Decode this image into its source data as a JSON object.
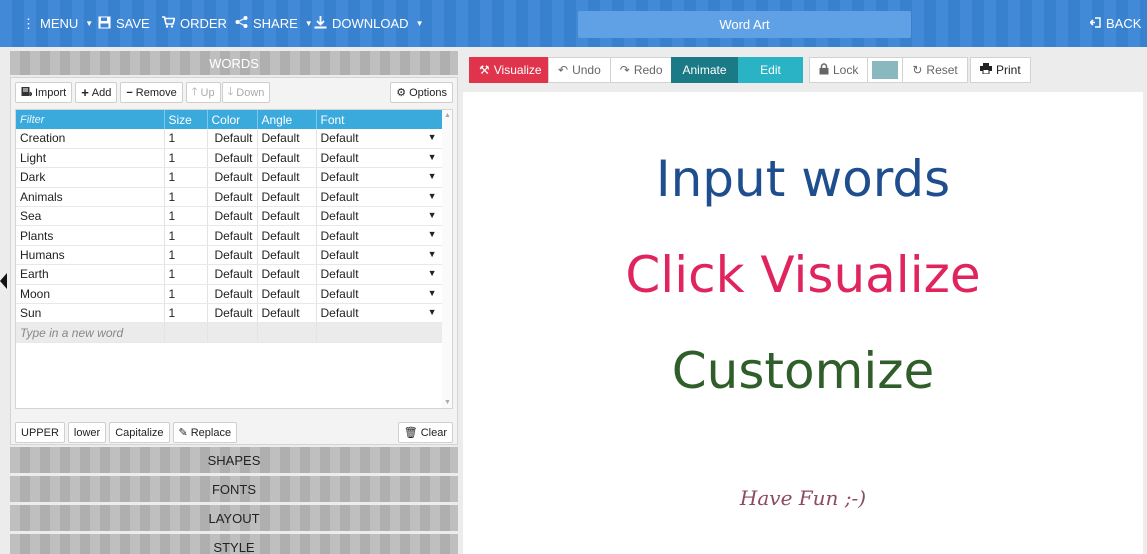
{
  "topbar": {
    "menu": "MENU",
    "save": "SAVE",
    "order": "ORDER",
    "share": "SHARE",
    "download": "DOWNLOAD",
    "title": "Word Art",
    "back": "BACK"
  },
  "words_panel": {
    "header": "WORDS",
    "toolbar": {
      "import": "Import",
      "add": "Add",
      "remove": "Remove",
      "up": "Up",
      "down": "Down",
      "options": "Options"
    },
    "columns": {
      "filter": "Filter",
      "size": "Size",
      "color": "Color",
      "angle": "Angle",
      "font": "Font"
    },
    "rows": [
      {
        "word": "Creation",
        "size": "1",
        "color": "Default",
        "angle": "Default",
        "font": "Default"
      },
      {
        "word": "Light",
        "size": "1",
        "color": "Default",
        "angle": "Default",
        "font": "Default"
      },
      {
        "word": "Dark",
        "size": "1",
        "color": "Default",
        "angle": "Default",
        "font": "Default"
      },
      {
        "word": "Animals",
        "size": "1",
        "color": "Default",
        "angle": "Default",
        "font": "Default"
      },
      {
        "word": "Sea",
        "size": "1",
        "color": "Default",
        "angle": "Default",
        "font": "Default"
      },
      {
        "word": "Plants",
        "size": "1",
        "color": "Default",
        "angle": "Default",
        "font": "Default"
      },
      {
        "word": "Humans",
        "size": "1",
        "color": "Default",
        "angle": "Default",
        "font": "Default"
      },
      {
        "word": "Earth",
        "size": "1",
        "color": "Default",
        "angle": "Default",
        "font": "Default"
      },
      {
        "word": "Moon",
        "size": "1",
        "color": "Default",
        "angle": "Default",
        "font": "Default"
      },
      {
        "word": "Sun",
        "size": "1",
        "color": "Default",
        "angle": "Default",
        "font": "Default"
      }
    ],
    "new_word_placeholder": "Type in a new word",
    "bottom": {
      "upper": "UPPER",
      "lower": "lower",
      "capitalize": "Capitalize",
      "replace": "Replace",
      "clear": "Clear"
    }
  },
  "sections": {
    "shapes": "SHAPES",
    "fonts": "FONTS",
    "layout": "LAYOUT",
    "style": "STYLE"
  },
  "right_toolbar": {
    "visualize": "Visualize",
    "undo": "Undo",
    "redo": "Redo",
    "animate": "Animate",
    "edit": "Edit",
    "lock": "Lock",
    "reset": "Reset",
    "print": "Print"
  },
  "canvas": {
    "line1": "Input words",
    "line2": "Click Visualize",
    "line3": "Customize",
    "line4": "Have Fun ;-)"
  },
  "colors": {
    "topbar": "#3a85d6",
    "visualize": "#e0344d",
    "animate": "#1a7a86",
    "edit": "#2ab3c4",
    "line1": "#1f4e8e",
    "line2": "#e0245e",
    "line3": "#2f5e2a",
    "line4": "#8c4a63",
    "swatch": "#8ab8bf"
  }
}
